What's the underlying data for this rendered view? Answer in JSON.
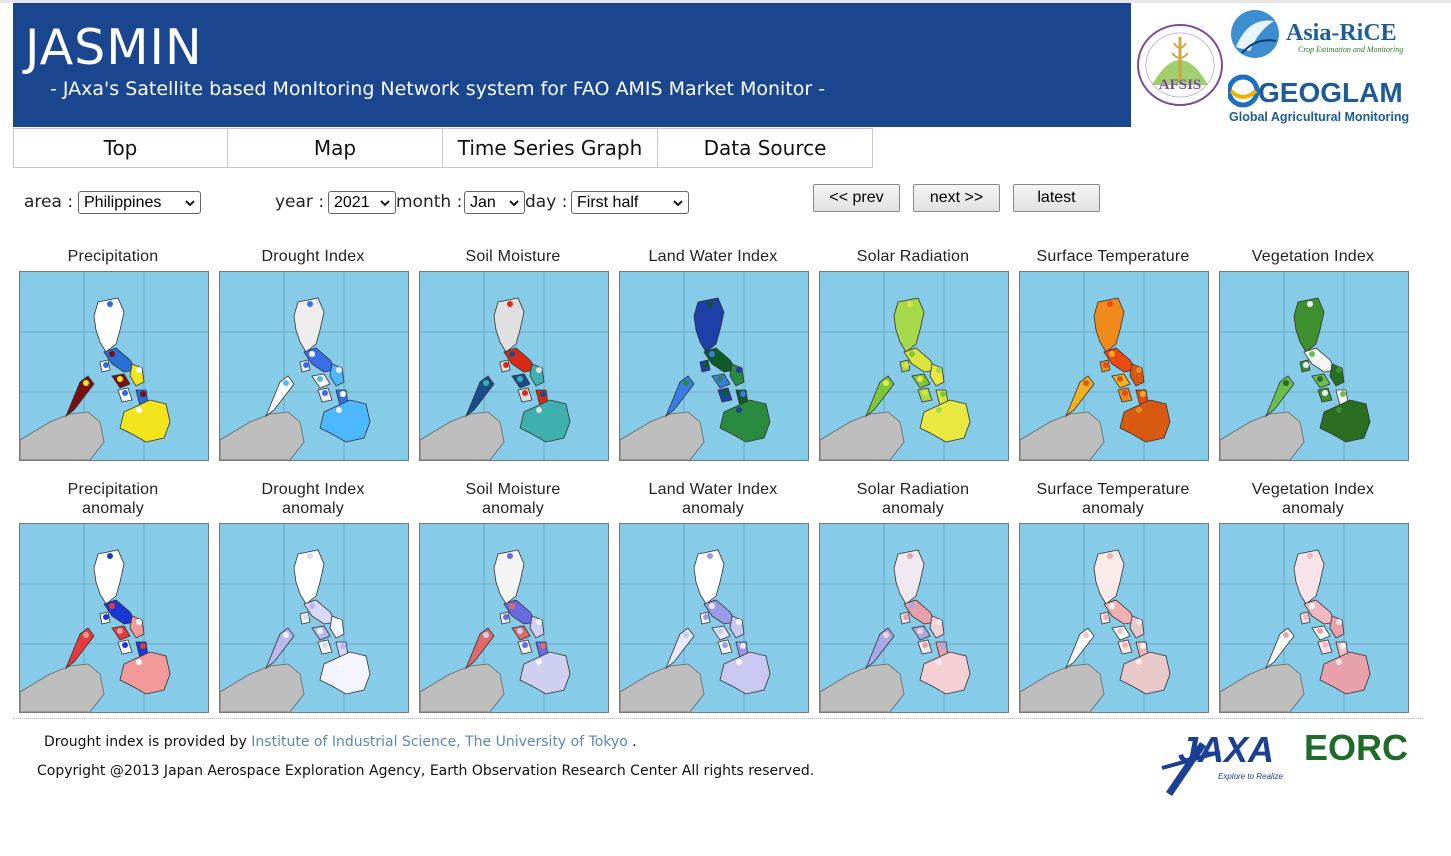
{
  "app": {
    "title": "JASMIN",
    "subtitle": "- JAxa's Satellite based MonItoring Network system for FAO AMIS Market Monitor -"
  },
  "logos": {
    "asiarice": "Asia-RiCE",
    "asiarice_tagline": "Crop Estimation and Monitoring",
    "geoglam": "GEOGLAM",
    "geoglam_tagline": "Global Agricultural Monitoring",
    "afsis": "AFSIS",
    "jaxa": "JAXA",
    "jaxa_tagline": "Explore to Realize",
    "eorc": "EORC"
  },
  "nav": {
    "tabs": [
      {
        "label": "Top"
      },
      {
        "label": "Map"
      },
      {
        "label": "Time Series Graph"
      },
      {
        "label": "Data Source"
      }
    ]
  },
  "controls": {
    "area_label": "area :",
    "area_value": "Philippines",
    "year_label": "year :",
    "year_value": "2021",
    "month_label": "month :",
    "month_value": "Jan",
    "day_label": "day :",
    "day_value": "First half",
    "prev_label": "<< prev",
    "next_label": "next >>",
    "latest_label": "latest"
  },
  "panels_row1": [
    {
      "label": "Precipitation",
      "scheme": "precip"
    },
    {
      "label": "Drought Index",
      "scheme": "drought"
    },
    {
      "label": "Soil Moisture",
      "scheme": "soil"
    },
    {
      "label": "Land Water Index",
      "scheme": "lwi"
    },
    {
      "label": "Solar Radiation",
      "scheme": "solar"
    },
    {
      "label": "Surface Temperature",
      "scheme": "temp"
    },
    {
      "label": "Vegetation Index",
      "scheme": "veg"
    }
  ],
  "panels_row2": [
    {
      "label": "Precipitation",
      "sub": "anomaly",
      "scheme": "precip_anom"
    },
    {
      "label": "Drought Index",
      "sub": "anomaly",
      "scheme": "drought_anom"
    },
    {
      "label": "Soil Moisture",
      "sub": "anomaly",
      "scheme": "soil_anom"
    },
    {
      "label": "Land Water Index",
      "sub": "anomaly",
      "scheme": "lwi_anom"
    },
    {
      "label": "Solar Radiation",
      "sub": "anomaly",
      "scheme": "solar_anom"
    },
    {
      "label": "Surface Temperature",
      "sub": "anomaly",
      "scheme": "temp_anom"
    },
    {
      "label": "Vegetation Index",
      "sub": "anomaly",
      "scheme": "veg_anom"
    }
  ],
  "footer": {
    "drought_prefix": "Drought index is provided by ",
    "drought_link": "Institute of Industrial Science, The University of Tokyo",
    "drought_suffix": " .",
    "copyright": "Copyright @2013  Japan Aerospace Exploration Agency, Earth Observation Research Center All rights reserved."
  },
  "colors": {
    "banner": "#1a4690",
    "ocean": "#86cbe8",
    "land_outside": "#bdbdbd",
    "link": "#5b87b8"
  }
}
